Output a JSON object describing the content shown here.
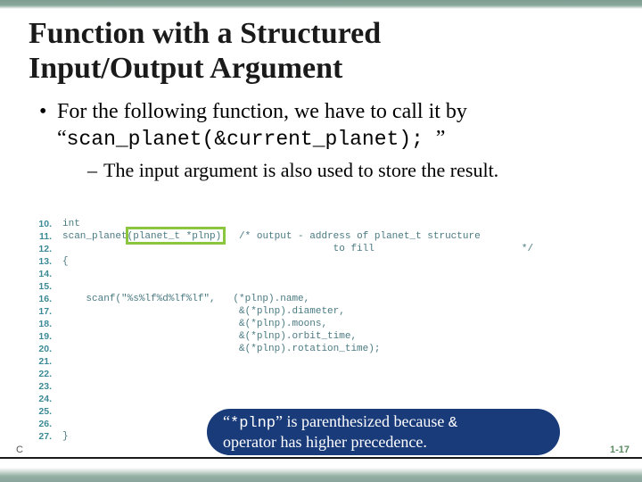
{
  "title_line1": "Function with a Structured",
  "title_line2": "Input/Output Argument",
  "bullet_main_1": "For the following function, we have to call it by",
  "bullet_main_2a": "“",
  "bullet_main_2_code": "scan_planet(",
  "bullet_main_2_op": "&",
  "bullet_main_2_code2": "current_planet); ",
  "bullet_main_2b": "”",
  "bullet_sub": "The input argument is also used to store the result.",
  "line_numbers": [
    "10.",
    "11.",
    "12.",
    "13.",
    "14.",
    "15.",
    "16.",
    "17.",
    "18.",
    "19.",
    "20.",
    "21.",
    "22.",
    "23.",
    "24.",
    "25.",
    "26.",
    "27."
  ],
  "code": {
    "l10": "int",
    "l11a": "scan_planet(planet_t *plnp)",
    "l11b": "/* output - address of planet_t structure",
    "l12": "                                              to fill                         */",
    "l13": "{",
    "l16": "    scanf(\"%s%lf%d%lf%lf\",   (*plnp).name,",
    "l17": "                              &(*plnp).diameter,",
    "l18": "                              &(*plnp).moons,",
    "l19": "                              &(*plnp).orbit_time,",
    "l20": "                              &(*plnp).rotation_time);",
    "l27": "}"
  },
  "callout_text_1a": "“",
  "callout_code": "*plnp",
  "callout_text_1b": "” is parenthesized because ",
  "callout_op": "&",
  "callout_text_2": "operator has higher precedence.",
  "page_number": "1-17",
  "copyright_stub": "C"
}
